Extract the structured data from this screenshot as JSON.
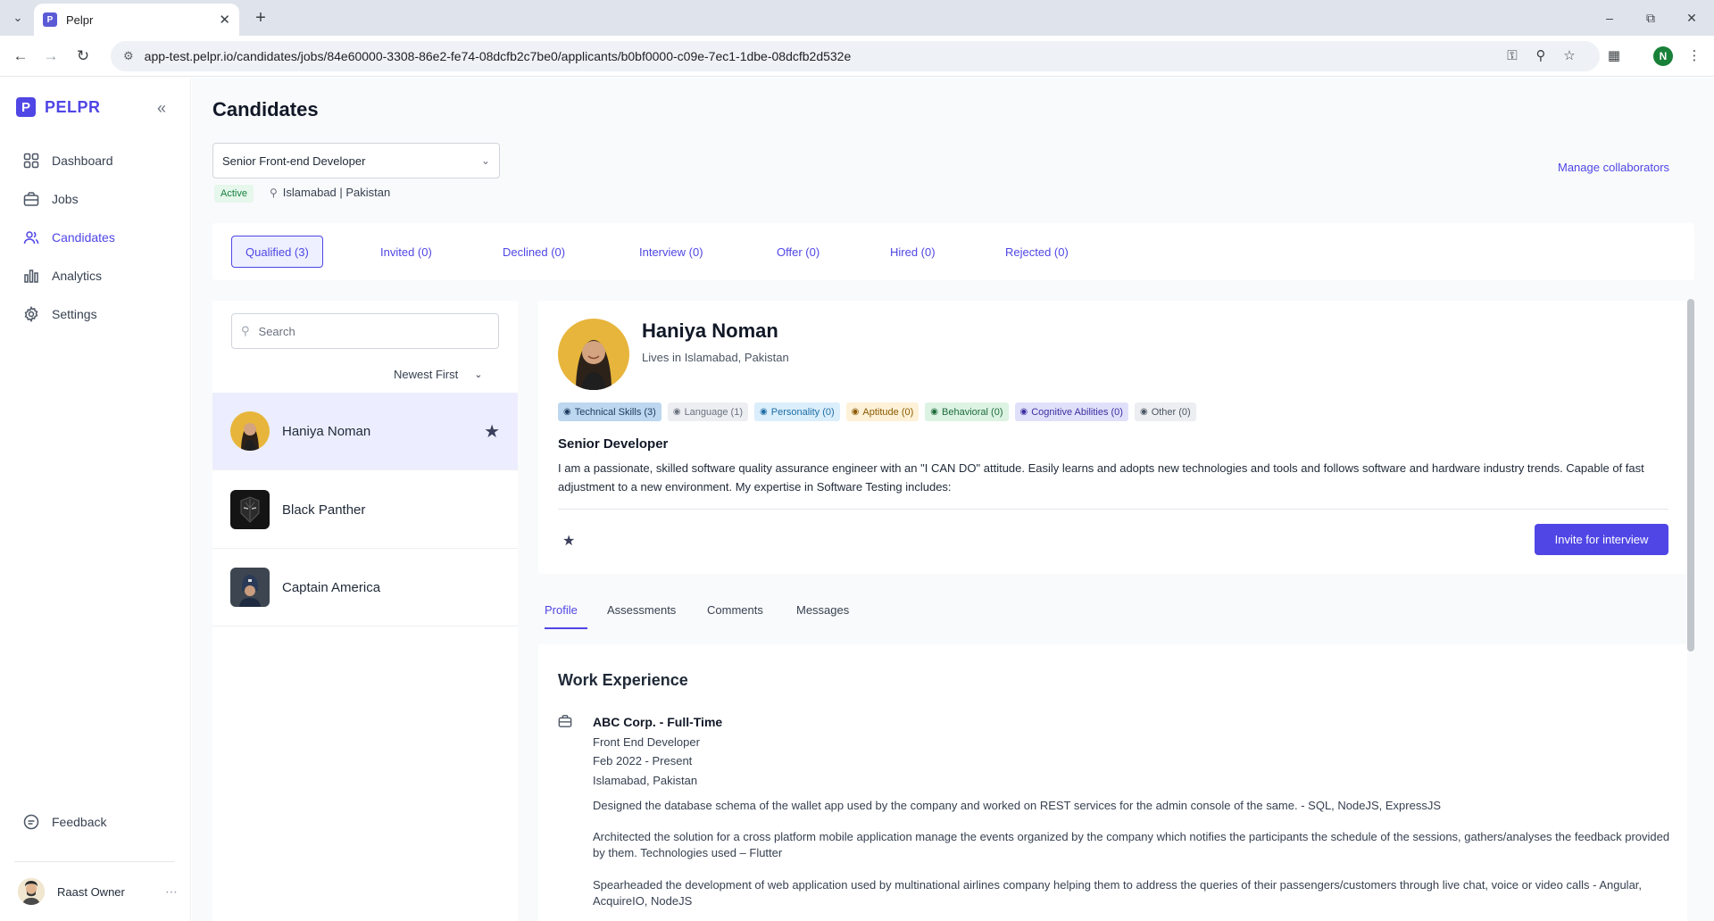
{
  "browser": {
    "tab_title": "Pelpr",
    "favicon_letter": "P",
    "url": "app-test.pelpr.io/candidates/jobs/84e60000-3308-86e2-fe74-08dcfb2c7be0/applicants/b0bf0000-c09e-7ec1-1dbe-08dcfb2d532e",
    "profile_initial": "N"
  },
  "sidebar": {
    "logo_letter": "P",
    "logo_text": "PELPR",
    "items": [
      {
        "label": "Dashboard",
        "icon": "grid-icon"
      },
      {
        "label": "Jobs",
        "icon": "briefcase-icon"
      },
      {
        "label": "Candidates",
        "icon": "users-icon"
      },
      {
        "label": "Analytics",
        "icon": "bar-chart-icon"
      },
      {
        "label": "Settings",
        "icon": "gear-icon"
      }
    ],
    "feedback_label": "Feedback",
    "user_name": "Raast Owner"
  },
  "header": {
    "title": "Candidates",
    "job_select_value": "Senior Front-end Developer",
    "status_badge": "Active",
    "location": "Islamabad | Pakistan",
    "manage_link": "Manage collaborators"
  },
  "status_tabs": [
    {
      "label": "Qualified (3)",
      "active": true
    },
    {
      "label": "Invited (0)"
    },
    {
      "label": "Declined (0)"
    },
    {
      "label": "Interview (0)"
    },
    {
      "label": "Offer (0)"
    },
    {
      "label": "Hired (0)"
    },
    {
      "label": "Rejected (0)"
    }
  ],
  "candidate_list": {
    "search_placeholder": "Search",
    "sort_label": "Newest First",
    "candidates": [
      {
        "name": "Haniya Noman",
        "starred": true,
        "active": true
      },
      {
        "name": "Black Panther"
      },
      {
        "name": "Captain America"
      }
    ]
  },
  "detail": {
    "name": "Haniya Noman",
    "lives_in": "Lives in Islamabad, Pakistan",
    "chips": [
      {
        "label": "Technical Skills (3)",
        "bg": "#bcd7ef",
        "fg": "#1e3a5f"
      },
      {
        "label": "Language (1)",
        "bg": "#eceef1",
        "fg": "#6b7280"
      },
      {
        "label": "Personality (0)",
        "bg": "#dbeefc",
        "fg": "#1d6fa5"
      },
      {
        "label": "Aptitude (0)",
        "bg": "#fdf1d7",
        "fg": "#8a5a00"
      },
      {
        "label": "Behavioral (0)",
        "bg": "#dcf3e3",
        "fg": "#1e6b3a"
      },
      {
        "label": "Cognitive Abilities (0)",
        "bg": "#e1e0fb",
        "fg": "#3b2fa0"
      },
      {
        "label": "Other (0)",
        "bg": "#eceef1",
        "fg": "#4b5563"
      }
    ],
    "role": "Senior Developer",
    "bio": "I am a passionate, skilled software quality assurance engineer with an \"I CAN DO\" attitude. Easily learns and adopts new technologies and tools and follows software and hardware industry trends. Capable of fast adjustment to a new environment. My expertise in Software Testing includes:",
    "invite_label": "Invite for interview",
    "tabs": [
      "Profile",
      "Assessments",
      "Comments",
      "Messages"
    ]
  },
  "work_experience": {
    "title": "Work Experience",
    "company": "ABC Corp. - Full-Time",
    "position": "Front End Developer",
    "period": "Feb 2022 - Present",
    "location": "Islamabad, Pakistan",
    "paragraphs": [
      "Designed the database schema of the wallet app used by the company and worked on REST services for the admin console of the same. - SQL, NodeJS, ExpressJS",
      "Architected the solution for a cross platform mobile application manage the events organized by the company which notifies the participants the schedule of the sessions, gathers/analyses the feedback provided by them. Technologies used – Flutter",
      "Spearheaded the development of web application used by multinational airlines company helping them to address the queries of their passengers/customers through live chat, voice or video calls - Angular, AcquireIO, NodeJS"
    ]
  }
}
